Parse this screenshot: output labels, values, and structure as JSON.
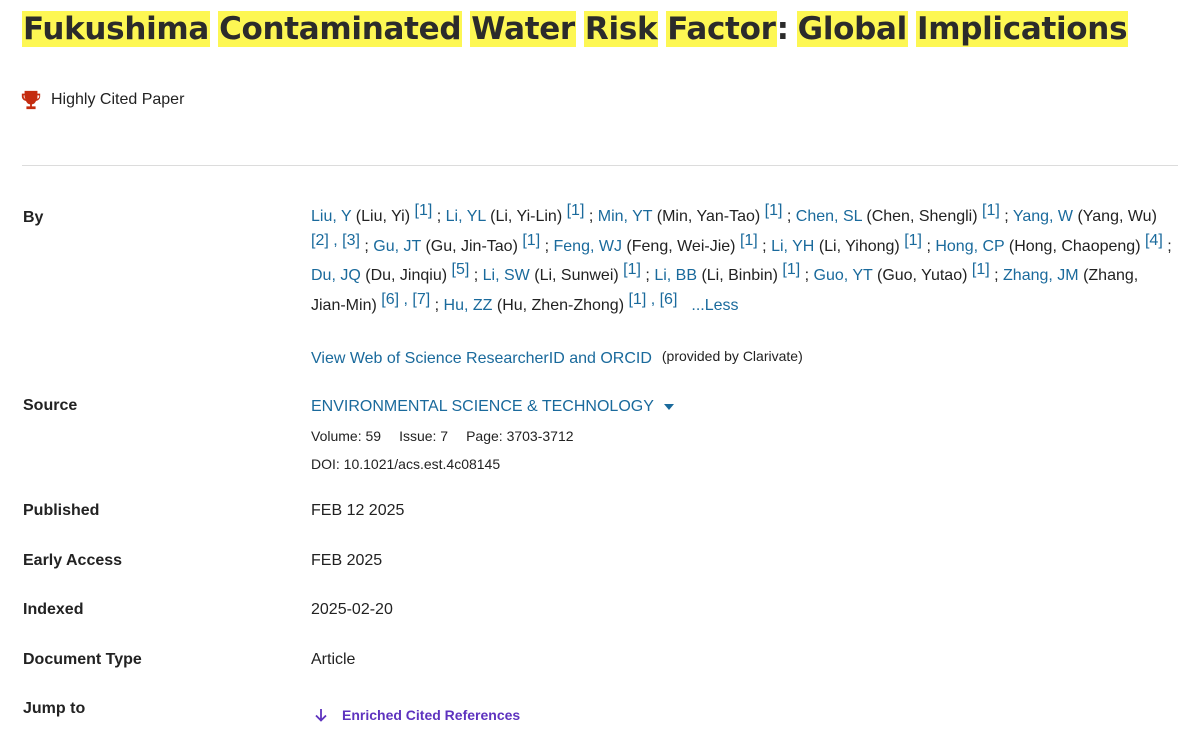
{
  "title": {
    "words": [
      "Fukushima",
      "Contaminated",
      "Water",
      "Risk",
      "Factor"
    ],
    "colon": ":",
    "words2": [
      "Global",
      "Implications"
    ]
  },
  "badge": {
    "label": "Highly Cited Paper",
    "icon": "trophy-icon",
    "icon_color": "#c42b0f"
  },
  "highlight_color": "#fdf753",
  "link_color": "#1a6a9c",
  "fields": {
    "by": "By",
    "source": "Source",
    "published": "Published",
    "early_access": "Early Access",
    "indexed": "Indexed",
    "document_type": "Document Type",
    "jump_to": "Jump to"
  },
  "authors": [
    {
      "short": "Liu, Y",
      "full": "(Liu, Yi)",
      "refs": "[1]"
    },
    {
      "short": "Li, YL",
      "full": "(Li, Yi-Lin)",
      "refs": "[1]"
    },
    {
      "short": "Min, YT",
      "full": "(Min, Yan-Tao)",
      "refs": "[1]"
    },
    {
      "short": "Chen, SL",
      "full": "(Chen, Shengli)",
      "refs": "[1]"
    },
    {
      "short": "Yang, W",
      "full": "(Yang, Wu)",
      "refs": "[2] , [3]"
    },
    {
      "short": "Gu, JT",
      "full": "(Gu, Jin-Tao)",
      "refs": "[1]"
    },
    {
      "short": "Feng, WJ",
      "full": "(Feng, Wei-Jie)",
      "refs": "[1]"
    },
    {
      "short": "Li, YH",
      "full": "(Li, Yihong)",
      "refs": "[1]"
    },
    {
      "short": "Hong, CP",
      "full": "(Hong, Chaopeng)",
      "refs": "[4]"
    },
    {
      "short": "Du, JQ",
      "full": "(Du, Jinqiu)",
      "refs": "[5]"
    },
    {
      "short": "Li, SW",
      "full": "(Li, Sunwei)",
      "refs": "[1]"
    },
    {
      "short": "Li, BB",
      "full": "(Li, Binbin)",
      "refs": "[1]"
    },
    {
      "short": "Guo, YT",
      "full": "(Guo, Yutao)",
      "refs": "[1]"
    },
    {
      "short": "Zhang, JM",
      "full": "(Zhang, Jian-Min)",
      "refs": "[6] , [7]"
    },
    {
      "short": "Hu, ZZ",
      "full": "(Hu, Zhen-Zhong)",
      "refs": "[1] , [6]"
    }
  ],
  "authors_less": "...Less",
  "researcher_link": "View Web of Science ResearcherID and ORCID",
  "provided_by": "(provided by Clarivate)",
  "source": {
    "journal": "ENVIRONMENTAL SCIENCE & TECHNOLOGY",
    "volume": "Volume: 59",
    "issue": "Issue: 7",
    "page": "Page: 3703-3712",
    "doi": "DOI: 10.1021/acs.est.4c08145"
  },
  "published": "FEB 12 2025",
  "early_access": "FEB 2025",
  "indexed": "2025-02-20",
  "document_type": "Article",
  "jump_to": {
    "label": "Enriched Cited References",
    "icon": "arrow-down-icon",
    "color": "#5e33bf"
  }
}
